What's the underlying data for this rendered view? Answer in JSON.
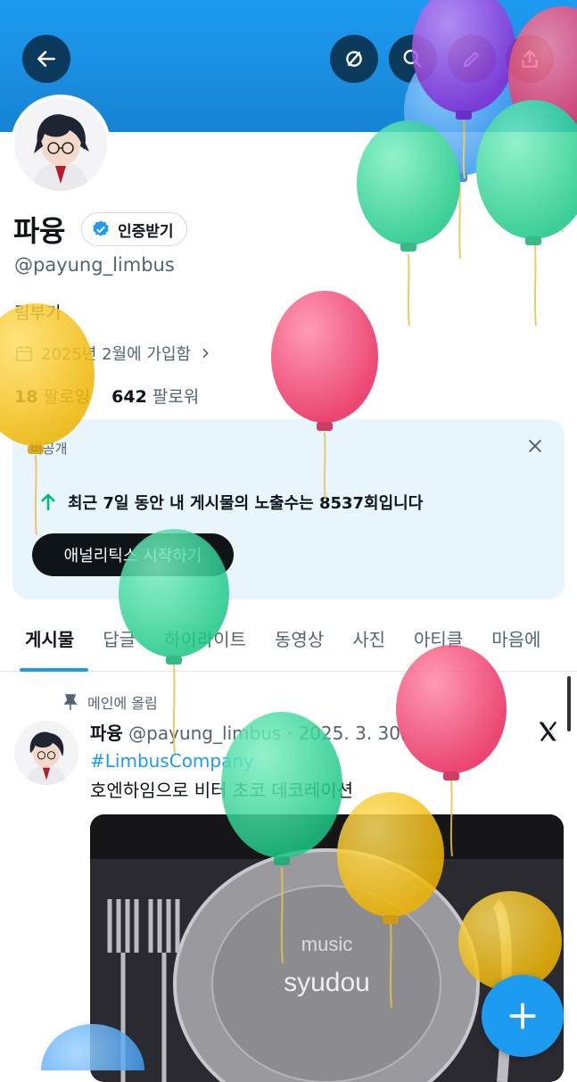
{
  "profile": {
    "name": "파융",
    "verify_label": "인증받기",
    "handle": "@payung_limbus",
    "bio": "림부기",
    "joined": "2025년 2월에 가입함",
    "following_count": "18",
    "following_label": "팔로잉",
    "followers_count": "642",
    "followers_label": "팔로워"
  },
  "analytics_card": {
    "label": "비공개",
    "message": "최근 7일 동안 내 게시물의 노출수는 8537회입니다",
    "cta": "애널리틱스 시작하기"
  },
  "tabs": [
    "게시물",
    "답글",
    "하이라이트",
    "동영상",
    "사진",
    "아티클",
    "마음에"
  ],
  "pinned_label": "메인에 올림",
  "post": {
    "author": "파융",
    "handle": "@payung_limbus",
    "date": "· 2025. 3. 30.",
    "hashtag": "#LimbusCompany",
    "text": "호엔하임으로 비터 초코 데코레이션",
    "media_line1": "music",
    "media_line2": "syudou"
  },
  "icons": {
    "back": "arrow-left-icon",
    "unmute": "no-signal-icon",
    "search": "search-icon",
    "edit": "pencil-icon",
    "share": "share-icon",
    "calendar": "calendar-icon",
    "pin": "pin-icon",
    "x_logo": "x-logo-icon",
    "compose": "plus-icon"
  },
  "colors": {
    "accent": "#1d9bf0",
    "banner": "#1d9bf0",
    "green_arrow": "#00ba7c",
    "card_bg": "#e8f5fd"
  }
}
